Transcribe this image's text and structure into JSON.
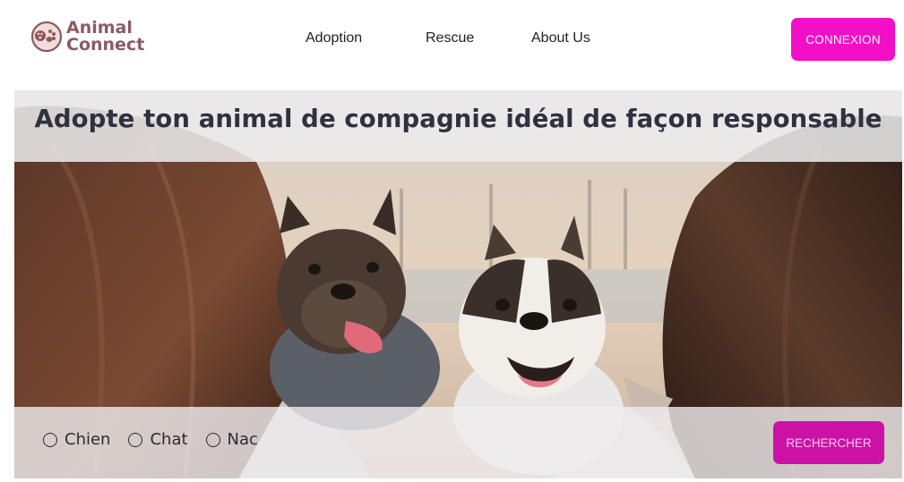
{
  "brand": {
    "name_line1": "Animal",
    "name_line2": "Connect",
    "color": "#8b5a62"
  },
  "nav": {
    "items": [
      {
        "label": "Adoption"
      },
      {
        "label": "Rescue"
      },
      {
        "label": "About Us"
      }
    ]
  },
  "header": {
    "login_label": "CONNEXION",
    "login_color": "#f20fc8"
  },
  "hero": {
    "title": "Adopte ton animal de compagnie idéal de façon responsable",
    "image_icon": "hero-photo"
  },
  "filters": {
    "options": [
      {
        "label": "Chien",
        "selected": false
      },
      {
        "label": "Chat",
        "selected": false
      },
      {
        "label": "Nac",
        "selected": false
      }
    ],
    "search_label": "RECHERCHER",
    "search_color": "#cc12a6"
  }
}
